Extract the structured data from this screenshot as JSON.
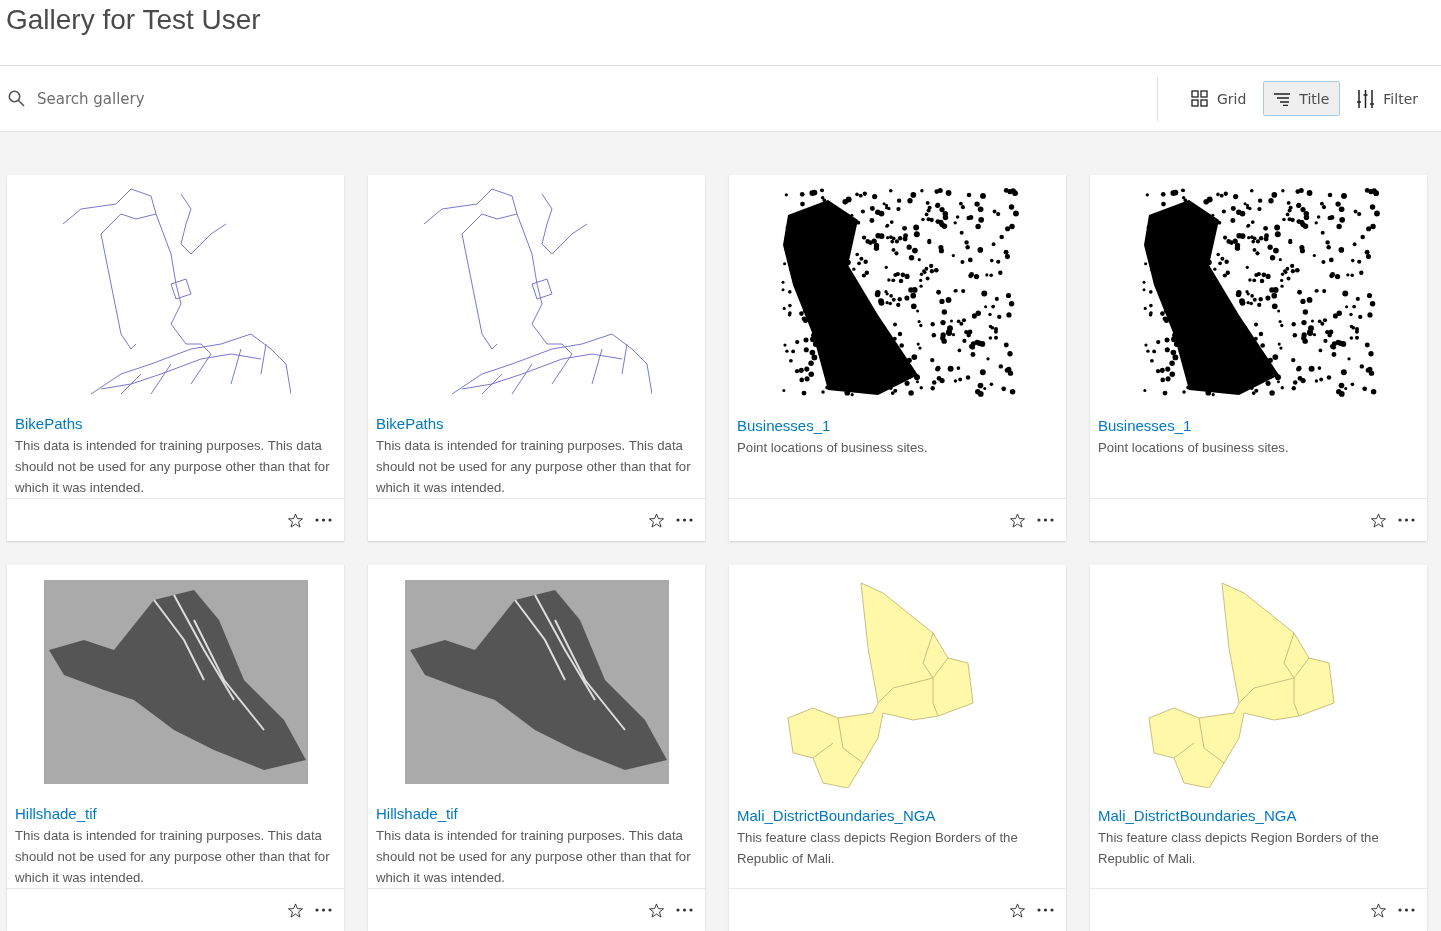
{
  "title": "Gallery for Test User",
  "search": {
    "placeholder": "Search gallery"
  },
  "view_buttons": [
    {
      "label": "Grid",
      "kind": "grid",
      "selected": false
    },
    {
      "label": "Title",
      "kind": "sort",
      "selected": true
    },
    {
      "label": "Filter",
      "kind": "filter",
      "selected": false
    }
  ],
  "items": [
    {
      "title": "BikePaths",
      "description": "This data is intended for training purposes. This data should not be used for any purpose other than that for which it was intended.",
      "kind": "lines"
    },
    {
      "title": "BikePaths",
      "description": "This data is intended for training purposes. This data should not be used for any purpose other than that for which it was intended.",
      "kind": "lines"
    },
    {
      "title": "Businesses_1",
      "description": "Point locations of business sites.",
      "kind": "points"
    },
    {
      "title": "Businesses_1",
      "description": "Point locations of business sites.",
      "kind": "points"
    },
    {
      "title": "Hillshade_tif",
      "description": "This data is intended for training purposes. This data should not be used for any purpose other than that for which it was intended.",
      "kind": "hillshade"
    },
    {
      "title": "Hillshade_tif",
      "description": "This data is intended for training purposes. This data should not be used for any purpose other than that for which it was intended.",
      "kind": "hillshade"
    },
    {
      "title": "Mali_DistrictBoundaries_NGA",
      "description": "This feature class depicts Region Borders of the Republic of Mali.",
      "kind": "polygons"
    },
    {
      "title": "Mali_DistrictBoundaries_NGA",
      "description": "This feature class depicts Region Borders of the Republic of Mali.",
      "kind": "polygons"
    }
  ]
}
